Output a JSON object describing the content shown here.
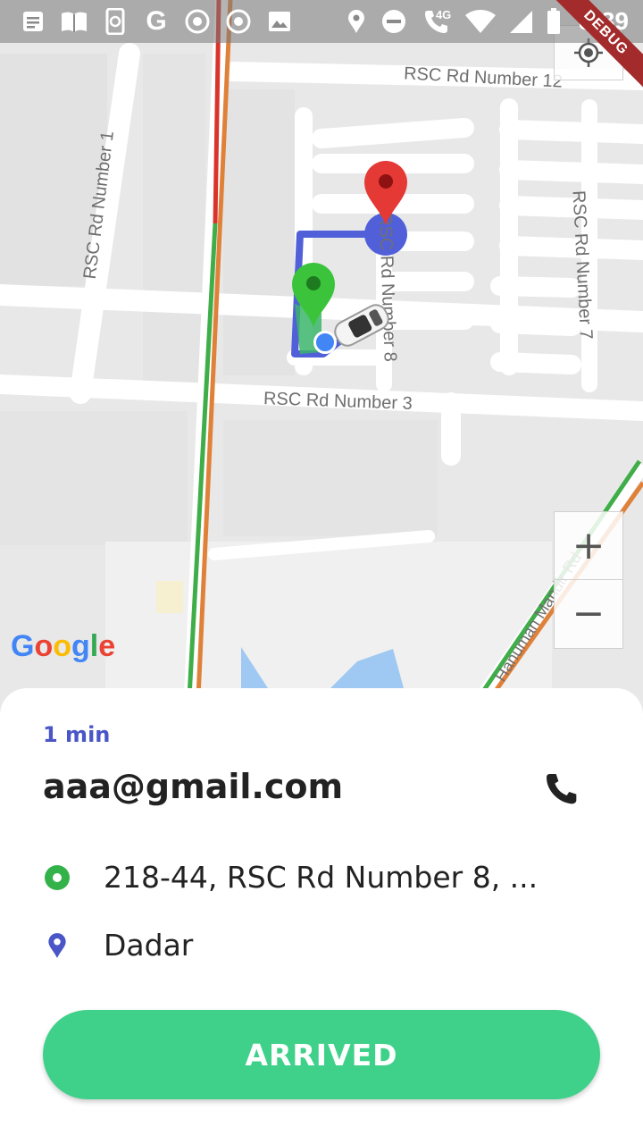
{
  "status_bar": {
    "time": "8:39",
    "network": "4G",
    "left_icons": [
      "notification-icon",
      "book-icon",
      "phone-sync-icon",
      "google-icon",
      "chrome-icon",
      "chrome-icon",
      "image-icon"
    ],
    "right_icons": [
      "location-icon",
      "dnd-icon",
      "call-icon",
      "wifi-icon",
      "signal-icon",
      "battery-icon"
    ]
  },
  "debug_banner": "DEBUG",
  "map": {
    "road_labels": [
      "RSC Rd Number 12",
      "RSC Rd Number 1",
      "RSC Rd Number 7",
      "RSC Rd Number 3",
      "RSC Rd Number 8",
      "Hanuman Mandir Rd"
    ],
    "google_logo": [
      "G",
      "o",
      "o",
      "g",
      "l",
      "e"
    ],
    "google_colors": [
      "#4285F4",
      "#EA4335",
      "#FBBC05",
      "#4285F4",
      "#34A853",
      "#EA4335"
    ],
    "zoom_in": "+",
    "zoom_out": "−",
    "pickup_marker_color": "#3bc43b",
    "drop_marker_color": "#e53935",
    "route_color": "#5160d8"
  },
  "trip": {
    "eta": "1 min",
    "email": "aaa@gmail.com",
    "pickup_address": "218-44, RSC Rd Number 8, ...",
    "drop_address": "Dadar",
    "action_label": "ARRIVED",
    "accent_color": "#3fd18a",
    "eta_color": "#4a56c8"
  }
}
